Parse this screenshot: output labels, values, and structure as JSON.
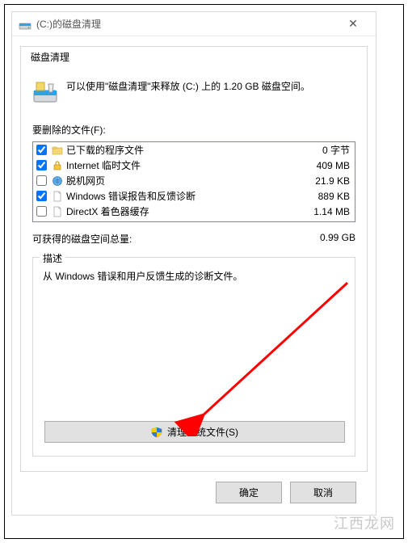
{
  "titlebar": {
    "title": "(C:)的磁盘清理"
  },
  "tab": {
    "label": "磁盘清理"
  },
  "info_text": "可以使用\"磁盘清理\"来释放  (C:) 上的 1.20 GB 磁盘空间。",
  "files_label": "要删除的文件(F):",
  "files": [
    {
      "checked": true,
      "icon": "folder",
      "name": "已下载的程序文件",
      "size": "0 字节"
    },
    {
      "checked": true,
      "icon": "lock",
      "name": "Internet 临时文件",
      "size": "409 MB"
    },
    {
      "checked": false,
      "icon": "globe",
      "name": "脱机网页",
      "size": "21.9 KB"
    },
    {
      "checked": true,
      "icon": "file",
      "name": "Windows 错误报告和反馈诊断",
      "size": "889 KB"
    },
    {
      "checked": false,
      "icon": "file",
      "name": "DirectX 着色器缓存",
      "size": "1.14 MB"
    }
  ],
  "total": {
    "label": "可获得的磁盘空间总量:",
    "value": "0.99 GB"
  },
  "description": {
    "legend": "描述",
    "text": "从 Windows 错误和用户反馈生成的诊断文件。"
  },
  "clean_button": "清理系统文件(S)",
  "buttons": {
    "ok": "确定",
    "cancel": "取消"
  },
  "watermark": "江西龙网"
}
